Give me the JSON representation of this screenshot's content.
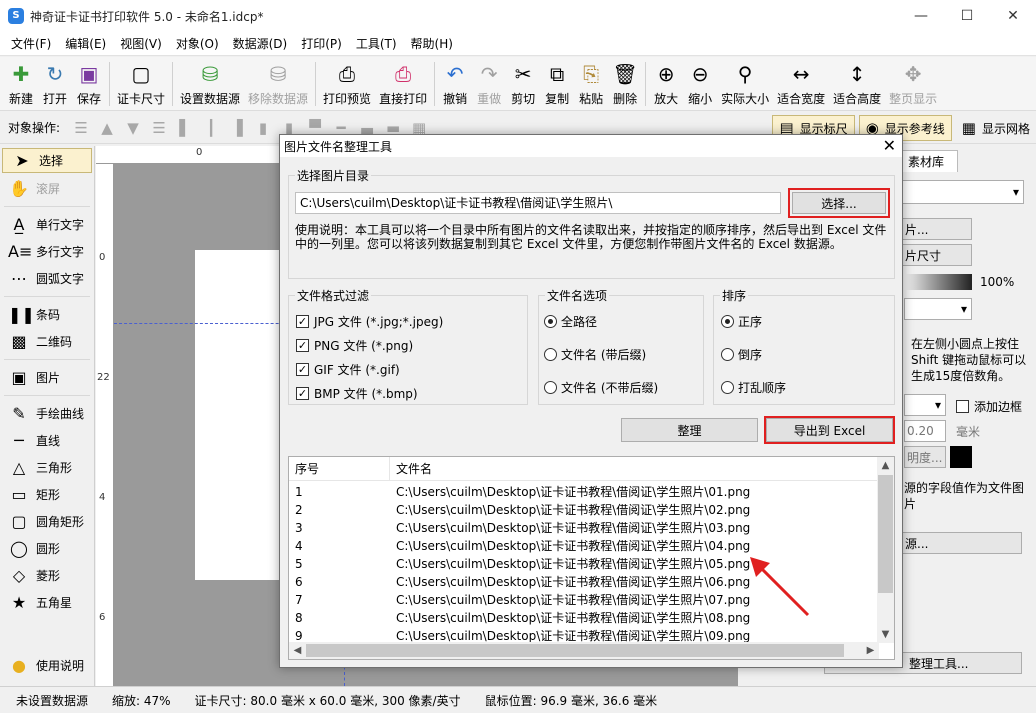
{
  "window": {
    "title": "神奇证卡证书打印软件 5.0 - 未命名1.idcp*",
    "app_icon": "S"
  },
  "menu": [
    "文件(F)",
    "编辑(E)",
    "视图(V)",
    "对象(O)",
    "数据源(D)",
    "打印(P)",
    "工具(T)",
    "帮助(H)"
  ],
  "toolbar": {
    "new": "新建",
    "open": "打开",
    "save": "保存",
    "card_size": "证卡尺寸",
    "set_datasource": "设置数据源",
    "remove_datasource": "移除数据源",
    "print_preview": "打印预览",
    "direct_print": "直接打印",
    "undo": "撤销",
    "redo": "重做",
    "cut": "剪切",
    "copy": "复制",
    "paste": "粘贴",
    "delete": "删除",
    "zoom_in": "放大",
    "zoom_out": "缩小",
    "actual_size": "实际大小",
    "fit_width": "适合宽度",
    "fit_height": "适合高度",
    "fit_page": "整页显示"
  },
  "ops": {
    "label": "对象操作:",
    "show_ruler": "显示标尺",
    "show_guides": "显示参考线",
    "show_grid": "显示网格"
  },
  "tools": {
    "select": "选择",
    "scroll": "滚屏",
    "single_text": "单行文字",
    "multi_text": "多行文字",
    "arc_text": "圆弧文字",
    "barcode": "条码",
    "qrcode": "二维码",
    "image": "图片",
    "freehand": "手绘曲线",
    "line": "直线",
    "triangle": "三角形",
    "rectangle": "矩形",
    "rounded_rect": "圆角矩形",
    "circle": "圆形",
    "diamond": "菱形",
    "star": "五角星",
    "help": "使用说明"
  },
  "ruler": {
    "h0": "0",
    "v1": "0",
    "v2": "22",
    "v3": "4",
    "v4": "6"
  },
  "right_panel": {
    "tab": "素材库",
    "btn1": "片...",
    "btn2": "片尺寸",
    "opacity": "100%",
    "hint": "在左侧小圆点上按住 Shift 键拖动鼠标可以生成15度倍数角。",
    "add_border": "添加边框",
    "stroke_value": "0.20",
    "unit": "毫米",
    "transparency": "明度...",
    "field_hint": "源的字段值作为文件图片",
    "source_btn": "源...",
    "organize_tool": "整理工具..."
  },
  "status": {
    "datasource": "未设置数据源",
    "zoom": "缩放: 47%",
    "card_size": "证卡尺寸: 80.0 毫米 x 60.0 毫米, 300 像素/英寸",
    "mouse": "鼠标位置: 96.9 毫米, 36.6 毫米"
  },
  "dialog": {
    "title": "图片文件名整理工具",
    "dir_group": "选择图片目录",
    "path": "C:\\Users\\cuilm\\Desktop\\证卡证书教程\\借阅证\\学生照片\\",
    "select_button": "选择...",
    "usage": "使用说明：本工具可以将一个目录中所有图片的文件名读取出来，并按指定的顺序排序，然后导出到 Excel 文件中的一列里。您可以将该列数据复制到其它 Excel 文件里，方便您制作带图片文件名的 Excel 数据源。",
    "filter_group": "文件格式过滤",
    "filters": [
      "JPG 文件 (*.jpg;*.jpeg)",
      "PNG 文件 (*.png)",
      "GIF 文件 (*.gif)",
      "BMP 文件 (*.bmp)"
    ],
    "name_group": "文件名选项",
    "name_options": [
      "全路径",
      "文件名 (带后缀)",
      "文件名 (不带后缀)"
    ],
    "sort_group": "排序",
    "sort_options": [
      "正序",
      "倒序",
      "打乱顺序"
    ],
    "organize_button": "整理",
    "export_button": "导出到 Excel",
    "col_index": "序号",
    "col_name": "文件名",
    "rows": [
      [
        "1",
        "C:\\Users\\cuilm\\Desktop\\证卡证书教程\\借阅证\\学生照片\\01.png"
      ],
      [
        "2",
        "C:\\Users\\cuilm\\Desktop\\证卡证书教程\\借阅证\\学生照片\\02.png"
      ],
      [
        "3",
        "C:\\Users\\cuilm\\Desktop\\证卡证书教程\\借阅证\\学生照片\\03.png"
      ],
      [
        "4",
        "C:\\Users\\cuilm\\Desktop\\证卡证书教程\\借阅证\\学生照片\\04.png"
      ],
      [
        "5",
        "C:\\Users\\cuilm\\Desktop\\证卡证书教程\\借阅证\\学生照片\\05.png"
      ],
      [
        "6",
        "C:\\Users\\cuilm\\Desktop\\证卡证书教程\\借阅证\\学生照片\\06.png"
      ],
      [
        "7",
        "C:\\Users\\cuilm\\Desktop\\证卡证书教程\\借阅证\\学生照片\\07.png"
      ],
      [
        "8",
        "C:\\Users\\cuilm\\Desktop\\证卡证书教程\\借阅证\\学生照片\\08.png"
      ],
      [
        "9",
        "C:\\Users\\cuilm\\Desktop\\证卡证书教程\\借阅证\\学生照片\\09.png"
      ]
    ]
  },
  "colors": {
    "highlight": "#e02020",
    "arrow": "#e02020",
    "accent": "#2b7fe0"
  }
}
